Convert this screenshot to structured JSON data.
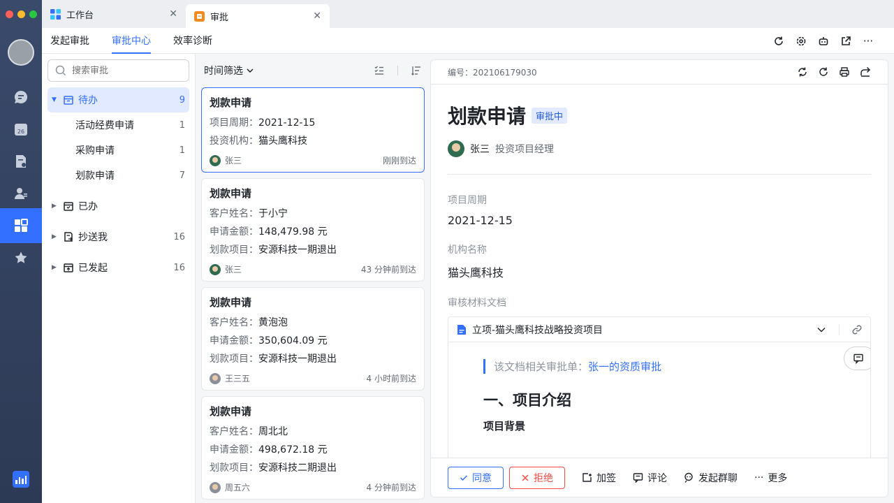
{
  "tabs": [
    {
      "label": "工作台",
      "icon": "workspace-icon"
    },
    {
      "label": "审批",
      "icon": "approval-app-icon"
    }
  ],
  "subnav": {
    "items": [
      "发起审批",
      "审批中心",
      "效率诊断"
    ],
    "active": "审批中心"
  },
  "search": {
    "placeholder": "搜索审批"
  },
  "categories": {
    "todo": {
      "label": "待办",
      "count": "9"
    },
    "todo_children": [
      {
        "label": "活动经费申请",
        "count": "1"
      },
      {
        "label": "采购申请",
        "count": "1"
      },
      {
        "label": "划款申请",
        "count": "7"
      }
    ],
    "done": {
      "label": "已办",
      "count": ""
    },
    "cc": {
      "label": "抄送我",
      "count": "16"
    },
    "started": {
      "label": "已发起",
      "count": "16"
    }
  },
  "list": {
    "filter_label": "时间筛选",
    "cards": [
      {
        "title": "划款申请",
        "rows": [
          {
            "key": "项目周期：",
            "value": "2021-12-15"
          },
          {
            "key": "投资机构：",
            "value": "猫头鹰科技"
          }
        ],
        "who": "张三",
        "time": "刚刚到达"
      },
      {
        "title": "划款申请",
        "rows": [
          {
            "key": "客户姓名：",
            "value": "于小宁"
          },
          {
            "key": "申请金额：",
            "value": "148,479.98 元"
          },
          {
            "key": "划款项目：",
            "value": "安源科技一期退出"
          }
        ],
        "who": "张三",
        "time": "43 分钟前到达"
      },
      {
        "title": "划款申请",
        "rows": [
          {
            "key": "客户姓名：",
            "value": "黄泡泡"
          },
          {
            "key": "申请金额：",
            "value": "350,604.09 元"
          },
          {
            "key": "划款项目：",
            "value": "安源科技一期退出"
          }
        ],
        "who": "王三五",
        "time": "4 小时前到达"
      },
      {
        "title": "划款申请",
        "rows": [
          {
            "key": "客户姓名：",
            "value": "周北北"
          },
          {
            "key": "申请金额：",
            "value": "498,672.18 元"
          },
          {
            "key": "划款项目：",
            "value": "安源科技二期退出"
          }
        ],
        "who": "周五六",
        "time": "4 分钟前到达"
      }
    ]
  },
  "detail": {
    "code": "编号：202106179030",
    "title": "划款申请",
    "status": "审批中",
    "applicant": "张三",
    "role": "投资项目经理",
    "fields": [
      {
        "label": "项目周期",
        "value": "2021-12-15"
      },
      {
        "label": "机构名称",
        "value": "猫头鹰科技"
      }
    ],
    "doc_label": "审核材料文档",
    "doc": {
      "name": "立项-猫头鹰科技战略投资项目",
      "quote_prefix": "该文档相关审批单：",
      "quote_link": "张一的资质审批",
      "h2": "一、项目介绍",
      "h3": "项目背景"
    },
    "actions": {
      "agree": "同意",
      "reject": "拒绝",
      "add_sign": "加签",
      "comment": "评论",
      "group_chat": "发起群聊",
      "more": "更多"
    }
  },
  "colors": {
    "accent": "#3370ff",
    "danger": "#f54a45",
    "rail": "#3a4a6b"
  }
}
